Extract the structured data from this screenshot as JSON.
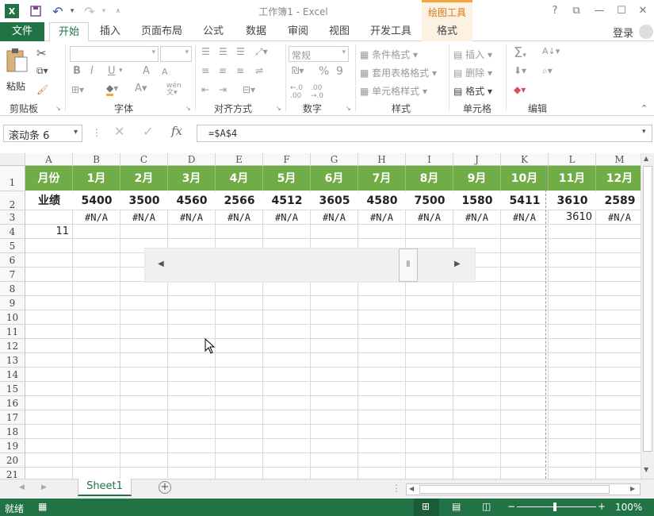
{
  "window": {
    "title": "工作簿1 - Excel",
    "context_group": "绘图工具",
    "help": "?",
    "ribbon_display": "⧉",
    "minimize": "—",
    "maximize": "☐",
    "close": "✕"
  },
  "quick_access": {
    "excel_logo": "X",
    "undo_dropdown": "▾",
    "redo_dropdown": "▾",
    "customize": "⩡"
  },
  "tabs": {
    "file": "文件",
    "items": [
      "开始",
      "插入",
      "页面布局",
      "公式",
      "数据",
      "审阅",
      "视图",
      "开发工具",
      "格式"
    ],
    "login": "登录"
  },
  "ribbon": {
    "clipboard": {
      "label": "剪贴板",
      "paste": "粘贴"
    },
    "font": {
      "label": "字体",
      "bold": "B",
      "italic": "I",
      "underline": "U",
      "grow": "A",
      "shrink": "A",
      "wen": "wén"
    },
    "alignment": {
      "label": "对齐方式"
    },
    "number": {
      "label": "数字",
      "format": "常规",
      "percent": "%",
      "comma": "9",
      "inc_decimal": "←.0\n.00",
      "dec_decimal": ".00\n→.0"
    },
    "styles": {
      "label": "样式",
      "conditional": "条件格式",
      "table": "套用表格格式",
      "cell": "单元格样式"
    },
    "cells": {
      "label": "单元格",
      "insert": "插入",
      "delete": "删除",
      "format": "格式"
    },
    "editing": {
      "label": "编辑",
      "sigma": "Σ",
      "sort": "A/Z"
    }
  },
  "formula_bar": {
    "name_box": "滚动条 6",
    "fx": "fx",
    "formula": "=$A$4"
  },
  "sheet": {
    "columns": [
      "A",
      "B",
      "C",
      "D",
      "E",
      "F",
      "G",
      "H",
      "I",
      "J",
      "K",
      "L",
      "M"
    ],
    "rows": [
      "1",
      "2",
      "3",
      "4",
      "5",
      "6",
      "7",
      "8",
      "9",
      "10",
      "11",
      "12",
      "13",
      "14",
      "15",
      "16",
      "17",
      "18",
      "19",
      "20",
      "21"
    ],
    "row1": [
      "月份",
      "1月",
      "2月",
      "3月",
      "4月",
      "5月",
      "6月",
      "7月",
      "8月",
      "9月",
      "10月",
      "11月",
      "12月"
    ],
    "row2": [
      "业绩",
      "5400",
      "3500",
      "4560",
      "2566",
      "4512",
      "3605",
      "4580",
      "7500",
      "1580",
      "5411",
      "3610",
      "2589"
    ],
    "row3": [
      "",
      "#N/A",
      "#N/A",
      "#N/A",
      "#N/A",
      "#N/A",
      "#N/A",
      "#N/A",
      "#N/A",
      "#N/A",
      "#N/A",
      "3610",
      "#N/A"
    ],
    "row4": [
      "11"
    ],
    "header_fill": "#70ad47",
    "scrollbar_value": 11
  },
  "sheet_tabs": {
    "tab": "Sheet1",
    "add": "+"
  },
  "status": {
    "ready": "就绪",
    "zoom": "100%",
    "zoom_minus": "−",
    "zoom_plus": "+"
  }
}
